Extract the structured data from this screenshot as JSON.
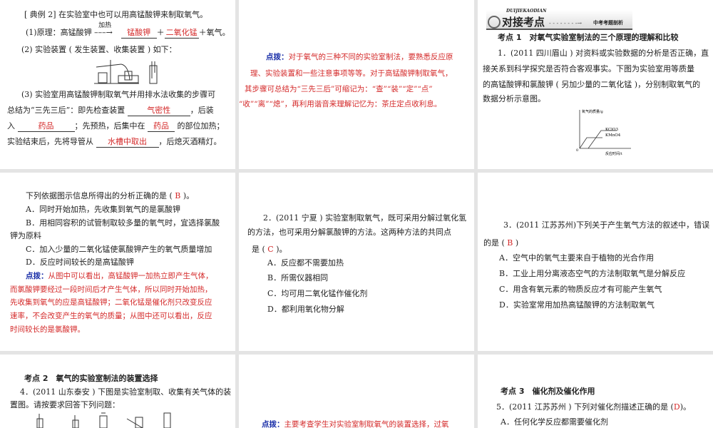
{
  "p1": {
    "title": "[ 典例 2] 在实验室中也可以用高锰酸钾来制取氧气。",
    "principle_prefix": "(1)原理：高锰酸钾",
    "heat_label": "加热",
    "product1": "锰酸钾",
    "plus1": "＋",
    "product2": "二氧化锰",
    "suffix": "＋氧气。",
    "apparatus": "(2) 实验装置 ( 发生装置、收集装置 ) 如下：",
    "steps_l1": "(3) 实验室用高锰酸钾制取氧气并用排水法收集的步骤可",
    "steps_l2a": "总结为“三先三后”：即先检查装置",
    "fill1": "气密性",
    "steps_l2b": "，后装",
    "steps_l3a": "入",
    "fill2": "药品",
    "steps_l3b": "；先预热，后集中在",
    "fill3": "药品",
    "steps_l3c": "的部位加热；",
    "steps_l4a": "实验结束后，先将导管从",
    "fill4": "水槽中取出",
    "steps_l4b": "，后熄灭酒精灯。"
  },
  "p2": {
    "hint_label": "点拨：",
    "lines": [
      "对于氧气的三种不同的实验室制法，要熟悉反应原",
      "理、实验装置和一些注意事项等等。对于高锰酸钾制取氧气，",
      "其步骤可总结为“三先三后”可缩记为：“查”“装”“定”“点”",
      "“收”“离”“熄”，再利用谐音来理解记忆为：茶庄定点收利息。"
    ]
  },
  "p3": {
    "banner_pinyin": "DUIJIEKAODIAN",
    "banner_title": "对接考点",
    "banner_sub": "中考考题剖析",
    "section": "考点 1　对氧气实验室制法的三个原理的理解和比较",
    "q_lines": [
      "1．(2011 四川眉山 ) 对资料或实验数据的分析是否正确，直",
      "接关系到科学探究是否符合客观事实。下图为实验室用等质量",
      "的高锰酸钾和氯酸钾 ( 另加少量的二氧化锰 )，分别制取氧气的",
      "数据分析示意图。"
    ],
    "chart": {
      "ylabel": "氧气的质量/g",
      "xlabel": "反应时间/t",
      "origin": "0",
      "series": [
        "KClO3",
        "KMnO4"
      ]
    }
  },
  "p4": {
    "stem_a": "下列依据图示信息所得出的分析正确的是 (",
    "answer": "B",
    "stem_b": ")。",
    "options": [
      "A．同时开始加热，先收集到氧气的是氯酸钾",
      "B．用相同容积的试管制取较多量的氧气时，宜选择氯酸",
      "钾为原料",
      "C．加入少量的二氧化锰使氯酸钾产生的氧气质量增加",
      "D．反应时间较长的是高锰酸钾"
    ],
    "hint_label": "点拨：",
    "hint_lines": [
      "从图中可以看出，高锰酸钾一加热立即产生气体，",
      "而氯酸钾要经过一段时间后才产生气体，所以同时开始加热，",
      "先收集到氧气的应是高锰酸钾；二氧化锰是催化剂只改变反应",
      "速率，不会改变产生的氧气的质量；从图中还可以看出，反应",
      "时间较长的是氯酸钾。"
    ]
  },
  "p5": {
    "lines": [
      "2．(2011 宁夏 ) 实验室制取氧气，既可采用分解过氧化氢",
      "的方法，也可采用分解氯酸钾的方法。这两种方法的共同点"
    ],
    "stem_a": "是 (",
    "answer": "C",
    "stem_b": ")。",
    "options": [
      "A．反应都不需要加热",
      "B．所需仪器相同",
      "C．均可用二氧化锰作催化剂",
      "D．都利用氧化物分解"
    ]
  },
  "p6": {
    "line1": "3．(2011 江苏苏州)下列关于产生氧气方法的叙述中，错误",
    "stem_a": "的是 (",
    "answer": "B",
    "stem_b": ")",
    "options": [
      "A．空气中的氧气主要来自于植物的光合作用",
      "B．工业上用分离液态空气的方法制取氧气是分解反应",
      "C．用含有氧元素的物质反应才有可能产生氧气",
      "D．实验室常用加热高锰酸钾的方法制取氧气"
    ]
  },
  "p7": {
    "section": "考点 2　氧气的实验室制法的装置选择",
    "lines": [
      "4．(2011 山东泰安 ) 下图是实验室制取、收集有关气体的装",
      "置图。请按要求回答下列问题："
    ]
  },
  "p8": {
    "hint_label": "点拨：",
    "hint": "主要考查学生对实验室制取氧气的装置选择，过氧"
  },
  "p9": {
    "section": "考点 3　催化剂及催化作用",
    "stem_a": "5．(2011 江苏苏州 ) 下列对催化剂描述正确的是 (",
    "answer": "D",
    "stem_b": ")。",
    "options": [
      "A．任何化学反应都需要催化剂"
    ]
  }
}
